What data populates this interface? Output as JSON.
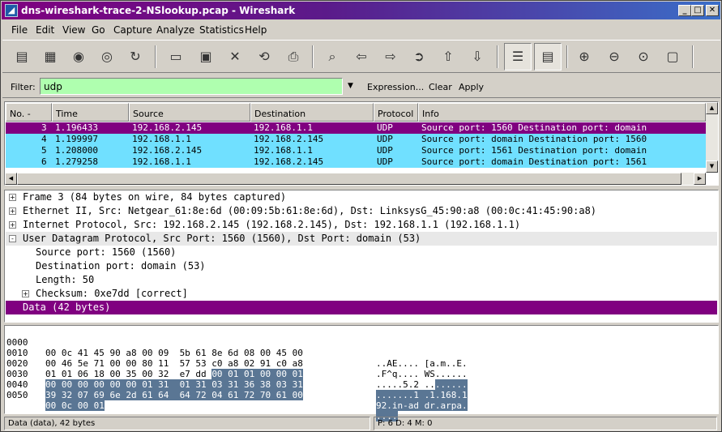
{
  "window": {
    "title": "dns-wireshark-trace-2-NSlookup.pcap - Wireshark",
    "min": "_",
    "max": "□",
    "close": "✕",
    "app_icon": "wireshark-fin-icon"
  },
  "menubar": [
    "File",
    "Edit",
    "View",
    "Go",
    "Capture",
    "Analyze",
    "Statistics",
    "Help"
  ],
  "filter": {
    "label": "Filter:",
    "value": "udp",
    "expression": "Expression...",
    "clear": "Clear",
    "apply": "Apply",
    "bg_color": "#afffaf"
  },
  "packet_list": {
    "columns": [
      "No.",
      "Time",
      "Source",
      "Destination",
      "Protocol",
      "Info"
    ],
    "sort_indicator": "-",
    "rows": [
      {
        "no": "3",
        "time": "1.196433",
        "src": "192.168.2.145",
        "dst": "192.168.1.1",
        "proto": "UDP",
        "info": "Source port: 1560  Destination port: domain"
      },
      {
        "no": "4",
        "time": "1.199997",
        "src": "192.168.1.1",
        "dst": "192.168.2.145",
        "proto": "UDP",
        "info": "Source port: domain  Destination port: 1560"
      },
      {
        "no": "5",
        "time": "1.208000",
        "src": "192.168.2.145",
        "dst": "192.168.1.1",
        "proto": "UDP",
        "info": "Source port: 1561  Destination port: domain"
      },
      {
        "no": "6",
        "time": "1.279258",
        "src": "192.168.1.1",
        "dst": "192.168.2.145",
        "proto": "UDP",
        "info": "Source port: domain  Destination port: 1561"
      }
    ],
    "colors": {
      "selected_bg": "#800080",
      "udp_bg": "#70e0ff"
    }
  },
  "packet_details": [
    {
      "text": "Frame 3 (84 bytes on wire, 84 bytes captured)",
      "expander": "+",
      "level": 0
    },
    {
      "text": "Ethernet II, Src: Netgear_61:8e:6d (00:09:5b:61:8e:6d), Dst: LinksysG_45:90:a8 (00:0c:41:45:90:a8)",
      "expander": "+",
      "level": 0
    },
    {
      "text": "Internet Protocol, Src: 192.168.2.145 (192.168.2.145), Dst: 192.168.1.1 (192.168.1.1)",
      "expander": "+",
      "level": 0
    },
    {
      "text": "User Datagram Protocol, Src Port: 1560 (1560), Dst Port: domain (53)",
      "expander": "-",
      "level": 0
    },
    {
      "text": "Source port: 1560 (1560)",
      "expander": "",
      "level": 1
    },
    {
      "text": "Destination port: domain (53)",
      "expander": "",
      "level": 1
    },
    {
      "text": "Length: 50",
      "expander": "",
      "level": 1
    },
    {
      "text": "Checksum: 0xe7dd [correct]",
      "expander": "+",
      "level": 1
    },
    {
      "text": "Data (42 bytes)",
      "expander": "",
      "level": 0
    }
  ],
  "bytes": [
    {
      "off": "0000",
      "hex": [
        "00 0c 41 45 90 a8 00 09  5b 61 8e 6d 08 00 45 00"
      ],
      "ascii": [
        "..AE.... [a.m..E."
      ]
    },
    {
      "off": "0010",
      "hex": [
        "00 46 5e 71 00 00 80 11  57 53 c0 a8 02 91 c0 a8"
      ],
      "ascii": [
        ".F^q.... WS......"
      ]
    },
    {
      "off": "0020",
      "hex": [
        "01 01 06 18 00 35 00 32  e7 dd ",
        "00 01 01 00 00 01"
      ],
      "ascii": [
        ".....5.2 ..",
        "......"
      ]
    },
    {
      "off": "0030",
      "hex": [
        "",
        "00 00 00 00 00 00 01 31  01 31 03 31 36 38 03 31"
      ],
      "ascii": [
        "",
        ".......1 .1.168.1"
      ]
    },
    {
      "off": "0040",
      "hex": [
        "",
        "39 32 07 69 6e 2d 61 64  64 72 04 61 72 70 61 00"
      ],
      "ascii": [
        "",
        "92.in-ad dr.arpa."
      ]
    },
    {
      "off": "0050",
      "hex": [
        "",
        "00 0c 00 01"
      ],
      "ascii": [
        "",
        "...."
      ]
    }
  ],
  "status": {
    "left": "Data (data), 42 bytes",
    "right": "P: 6 D: 4 M: 0"
  },
  "toolbar_icons": [
    "interface-list-icon",
    "capture-options-icon",
    "start-capture-icon",
    "stop-capture-icon",
    "restart-capture-icon",
    "open-icon",
    "save-icon",
    "close-file-icon",
    "reload-icon",
    "print-icon",
    "find-packet-icon",
    "go-back-icon",
    "go-forward-icon",
    "go-to-packet-icon",
    "go-first-icon",
    "go-last-icon",
    "colorize-icon",
    "auto-scroll-icon",
    "zoom-in-icon",
    "zoom-out-icon",
    "normal-size-icon",
    "resize-columns-icon"
  ]
}
